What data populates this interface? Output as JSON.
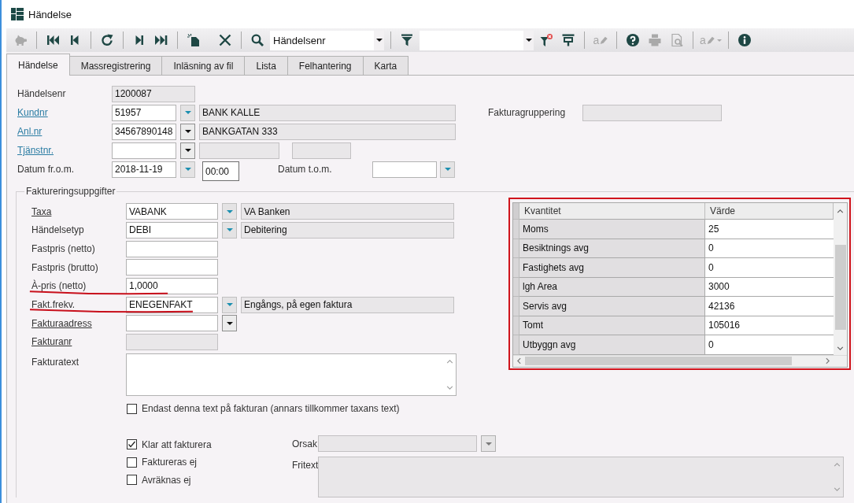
{
  "window": {
    "title": "Händelse"
  },
  "toolbar": {
    "groups": [
      [
        {
          "kind": "piggy-bank",
          "disabled": true
        }
      ],
      [
        {
          "kind": "first",
          "disabled": false
        },
        {
          "kind": "previous",
          "disabled": false
        }
      ],
      [
        {
          "kind": "refresh",
          "disabled": false
        }
      ],
      [
        {
          "kind": "next",
          "disabled": false
        },
        {
          "kind": "last",
          "disabled": false
        }
      ],
      [
        {
          "kind": "new",
          "disabled": false
        },
        {
          "kind": "delete",
          "disabled": false
        }
      ],
      [
        {
          "kind": "search",
          "disabled": false
        },
        {
          "kind": "combo",
          "value": "Händelsenr",
          "disabled": false
        }
      ],
      [
        {
          "kind": "filter",
          "disabled": false
        },
        {
          "kind": "combo",
          "disabled": false
        },
        {
          "kind": "clear-filter",
          "disabled": false
        },
        {
          "kind": "pin",
          "disabled": false
        }
      ],
      [
        {
          "kind": "spellcheck",
          "label": "a",
          "disabled": true
        }
      ],
      [
        {
          "kind": "help",
          "disabled": false
        },
        {
          "kind": "print",
          "disabled": true
        },
        {
          "kind": "preview",
          "disabled": true
        }
      ],
      [
        {
          "kind": "spellcheck-menu",
          "label": "a",
          "disabled": true
        }
      ],
      [
        {
          "kind": "info",
          "disabled": false
        }
      ]
    ]
  },
  "tabs": [
    {
      "label": "Händelse",
      "selected": true
    },
    {
      "label": "Massregistrering",
      "selected": false
    },
    {
      "label": "Inläsning av fil",
      "selected": false
    },
    {
      "label": "Lista",
      "selected": false
    },
    {
      "label": "Felhantering",
      "selected": false
    },
    {
      "label": "Karta",
      "selected": false
    }
  ],
  "event": {
    "number": {
      "label": "Händelsenr",
      "link": false,
      "value": "1200087",
      "readonly": true
    },
    "customer": {
      "label": "Kundnr",
      "link": true,
      "value": "51957",
      "description": "BANK KALLE"
    },
    "invoice_grouping": {
      "label": "Fakturagruppering",
      "link": false
    },
    "facility": {
      "label": "Anl.nr",
      "link": true,
      "value": "34567890148",
      "description": "BANKGATAN 333"
    },
    "service": {
      "label": "Tjänstnr.",
      "link": true
    },
    "date_from": {
      "label": "Datum fr.o.m.",
      "link": false,
      "value": "2018-11-19",
      "time": "00:00"
    },
    "date_to": {
      "label": "Datum t.o.m.",
      "link": false
    }
  },
  "billing": {
    "title": "Faktureringsuppgifter",
    "rows": [
      {
        "kind": "lookup",
        "label": "Taxa",
        "link": true,
        "value": "VABANK",
        "description": "VA Banken",
        "highlighted": false
      },
      {
        "kind": "lookup",
        "label": "Händelsetyp",
        "link": false,
        "value": "DEBI",
        "description": "Debitering",
        "highlighted": false
      },
      {
        "kind": "text",
        "label": "Fastpris (netto)",
        "link": false,
        "highlighted": false
      },
      {
        "kind": "text",
        "label": "Fastpris (brutto)",
        "link": false,
        "highlighted": false
      },
      {
        "kind": "text",
        "label": "À-pris (netto)",
        "link": false,
        "value": "1,0000",
        "highlighted": true
      },
      {
        "kind": "lookup",
        "label": "Fakt.frekv.",
        "link": false,
        "value": "ENEGENFAKT",
        "description": "Engångs, på egen faktura",
        "highlighted": true
      },
      {
        "kind": "list",
        "label": "Fakturaadress",
        "link": true,
        "highlighted": false
      },
      {
        "kind": "readonly",
        "label": "Fakturanr",
        "link": true,
        "highlighted": false
      }
    ],
    "invoice_text": {
      "label": "Fakturatext"
    },
    "only_this_text": {
      "label": "Endast denna text på fakturan (annars tillkommer taxans text)",
      "checked": false
    },
    "flags": [
      {
        "label": "Klar att fakturera",
        "checked": true
      },
      {
        "label": "Faktureras ej",
        "checked": false
      },
      {
        "label": "Avräknas ej",
        "checked": false
      }
    ],
    "reason": {
      "label": "Orsak",
      "disabled": true
    },
    "free_text": {
      "label": "Fritext",
      "disabled": true
    }
  },
  "properties": {
    "highlighted": true,
    "columns": [
      "Kvantitet",
      "Värde"
    ],
    "rows": [
      [
        "Moms",
        "25"
      ],
      [
        "Besiktnings avg",
        "0"
      ],
      [
        "Fastighets avg",
        "0"
      ],
      [
        "lgh Area",
        "3000"
      ],
      [
        "Servis avg",
        "42136"
      ],
      [
        "Tomt",
        "105016"
      ],
      [
        "Utbyggn avg",
        "0"
      ]
    ]
  }
}
